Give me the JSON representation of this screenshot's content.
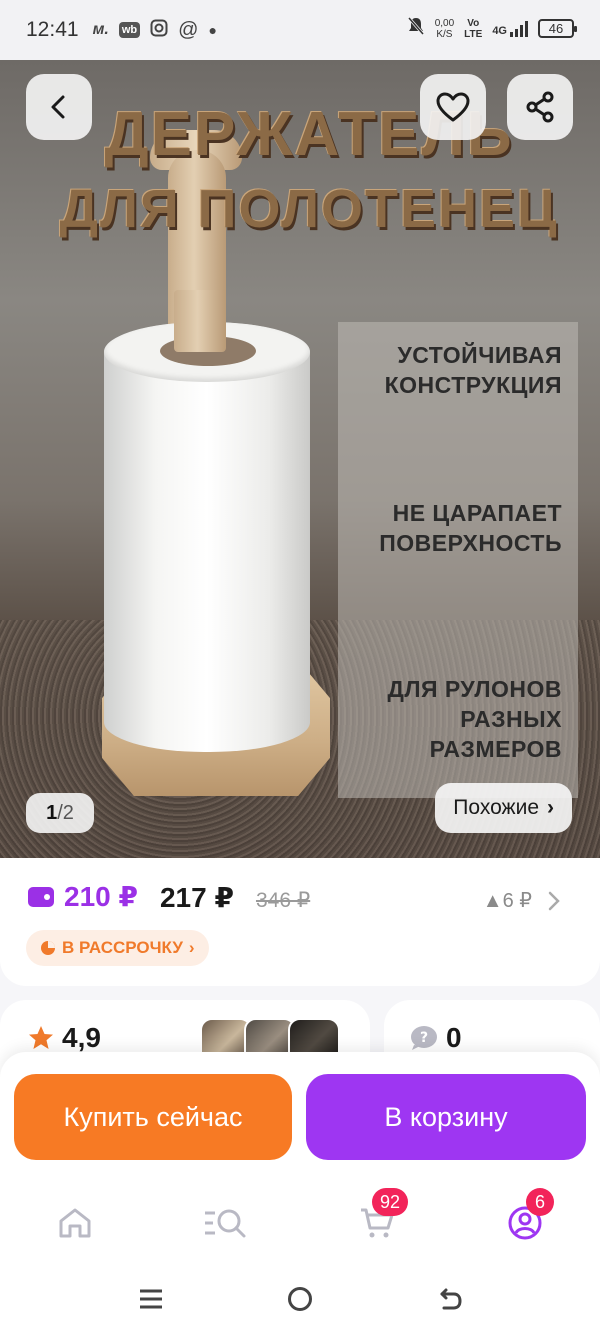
{
  "status_bar": {
    "time": "12:41",
    "icons": [
      "signal-m-icon",
      "wb-icon",
      "instagram-icon",
      "at-icon",
      "dot-icon"
    ],
    "wb_label": "wb",
    "speed_value": "0,00",
    "speed_unit": "K/S",
    "volte": "Vo",
    "lte": "LTE",
    "network": "4G",
    "battery": "46"
  },
  "hero": {
    "title_line1": "ДЕРЖАТЕЛЬ",
    "title_line2": "ДЛЯ ПОЛОТЕНЕЦ",
    "features": [
      {
        "line1": "УСТОЙЧИВАЯ",
        "line2": "КОНСТРУКЦИЯ"
      },
      {
        "line1": "НЕ ЦАРАПАЕТ",
        "line2": "ПОВЕРХНОСТЬ"
      },
      {
        "line1": "ДЛЯ РУЛОНОВ",
        "line2": "РАЗНЫХ",
        "line3": "РАЗМЕРОВ"
      }
    ],
    "pager": {
      "current": "1",
      "separator": "/",
      "total": "2"
    },
    "similar_label": "Похожие",
    "similar_chevron": "›"
  },
  "price": {
    "wallet_price": "210 ₽",
    "price": "217 ₽",
    "old_price": "346 ₽",
    "delta": "▲6 ₽",
    "installment_label": "В РАССРОЧКУ",
    "installment_chevron": "›"
  },
  "rating": {
    "value": "4,9",
    "questions": "0"
  },
  "actions": {
    "buy_now": "Купить сейчас",
    "add_to_cart": "В корзину"
  },
  "nav": {
    "cart_badge": "92",
    "profile_badge": "6"
  },
  "colors": {
    "accent_purple": "#9e36f2",
    "accent_orange": "#f77a24",
    "badge_red": "#f2245a",
    "wallet_purple": "#9b30e6"
  }
}
